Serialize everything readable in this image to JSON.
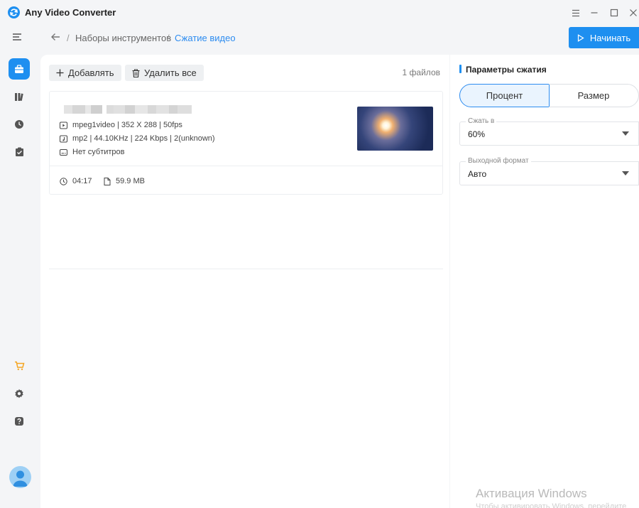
{
  "app": {
    "title": "Any Video Converter",
    "icon": "app-logo-icon"
  },
  "window": {
    "minimize_icon": "minimize-icon",
    "maximize_icon": "maximize-icon",
    "close_icon": "close-icon",
    "menu_icon": "hamburger-icon"
  },
  "breadcrumb": {
    "items": [
      "Наборы инструментов",
      "Сжатие видео"
    ],
    "separator": "/",
    "back_icon": "arrow-left-icon"
  },
  "start_button": {
    "label": "Начинать",
    "icon": "play-icon"
  },
  "sidebar": {
    "items": [
      {
        "name": "toolbox",
        "icon": "toolbox-icon",
        "active": true
      },
      {
        "name": "library",
        "icon": "library-icon",
        "active": false
      },
      {
        "name": "history",
        "icon": "clock-icon",
        "active": false
      },
      {
        "name": "tasks",
        "icon": "checklist-icon",
        "active": false
      }
    ],
    "bottom": [
      {
        "name": "store",
        "icon": "cart-icon"
      },
      {
        "name": "settings",
        "icon": "gear-icon"
      },
      {
        "name": "help",
        "icon": "help-icon"
      }
    ],
    "avatar_icon": "user-avatar-icon"
  },
  "toolbar": {
    "add_label": "Добавлять",
    "delete_all_label": "Удалить все",
    "files_count": "1 файлов"
  },
  "file": {
    "video_info": "mpeg1video | 352 X 288 | 50fps",
    "audio_info": "mp2 | 44.10KHz | 224 Kbps | 2(unknown)",
    "subtitle_info": "Нет субтитров",
    "duration": "04:17",
    "size": "59.9 MB"
  },
  "panel": {
    "title": "Параметры сжатия",
    "modes": [
      "Процент",
      "Размер"
    ],
    "selected_mode": "Процент",
    "compress": {
      "label": "Сжать в",
      "value": "60%"
    },
    "format": {
      "label": "Выходной формат",
      "value": "Авто"
    }
  },
  "watermark": {
    "title": "Активация Windows",
    "subtitle": "Чтобы активировать Windows, перейдите"
  },
  "colors": {
    "accent": "#1e8ff0",
    "link": "#2d8cf0",
    "background": "#f4f5f7"
  }
}
